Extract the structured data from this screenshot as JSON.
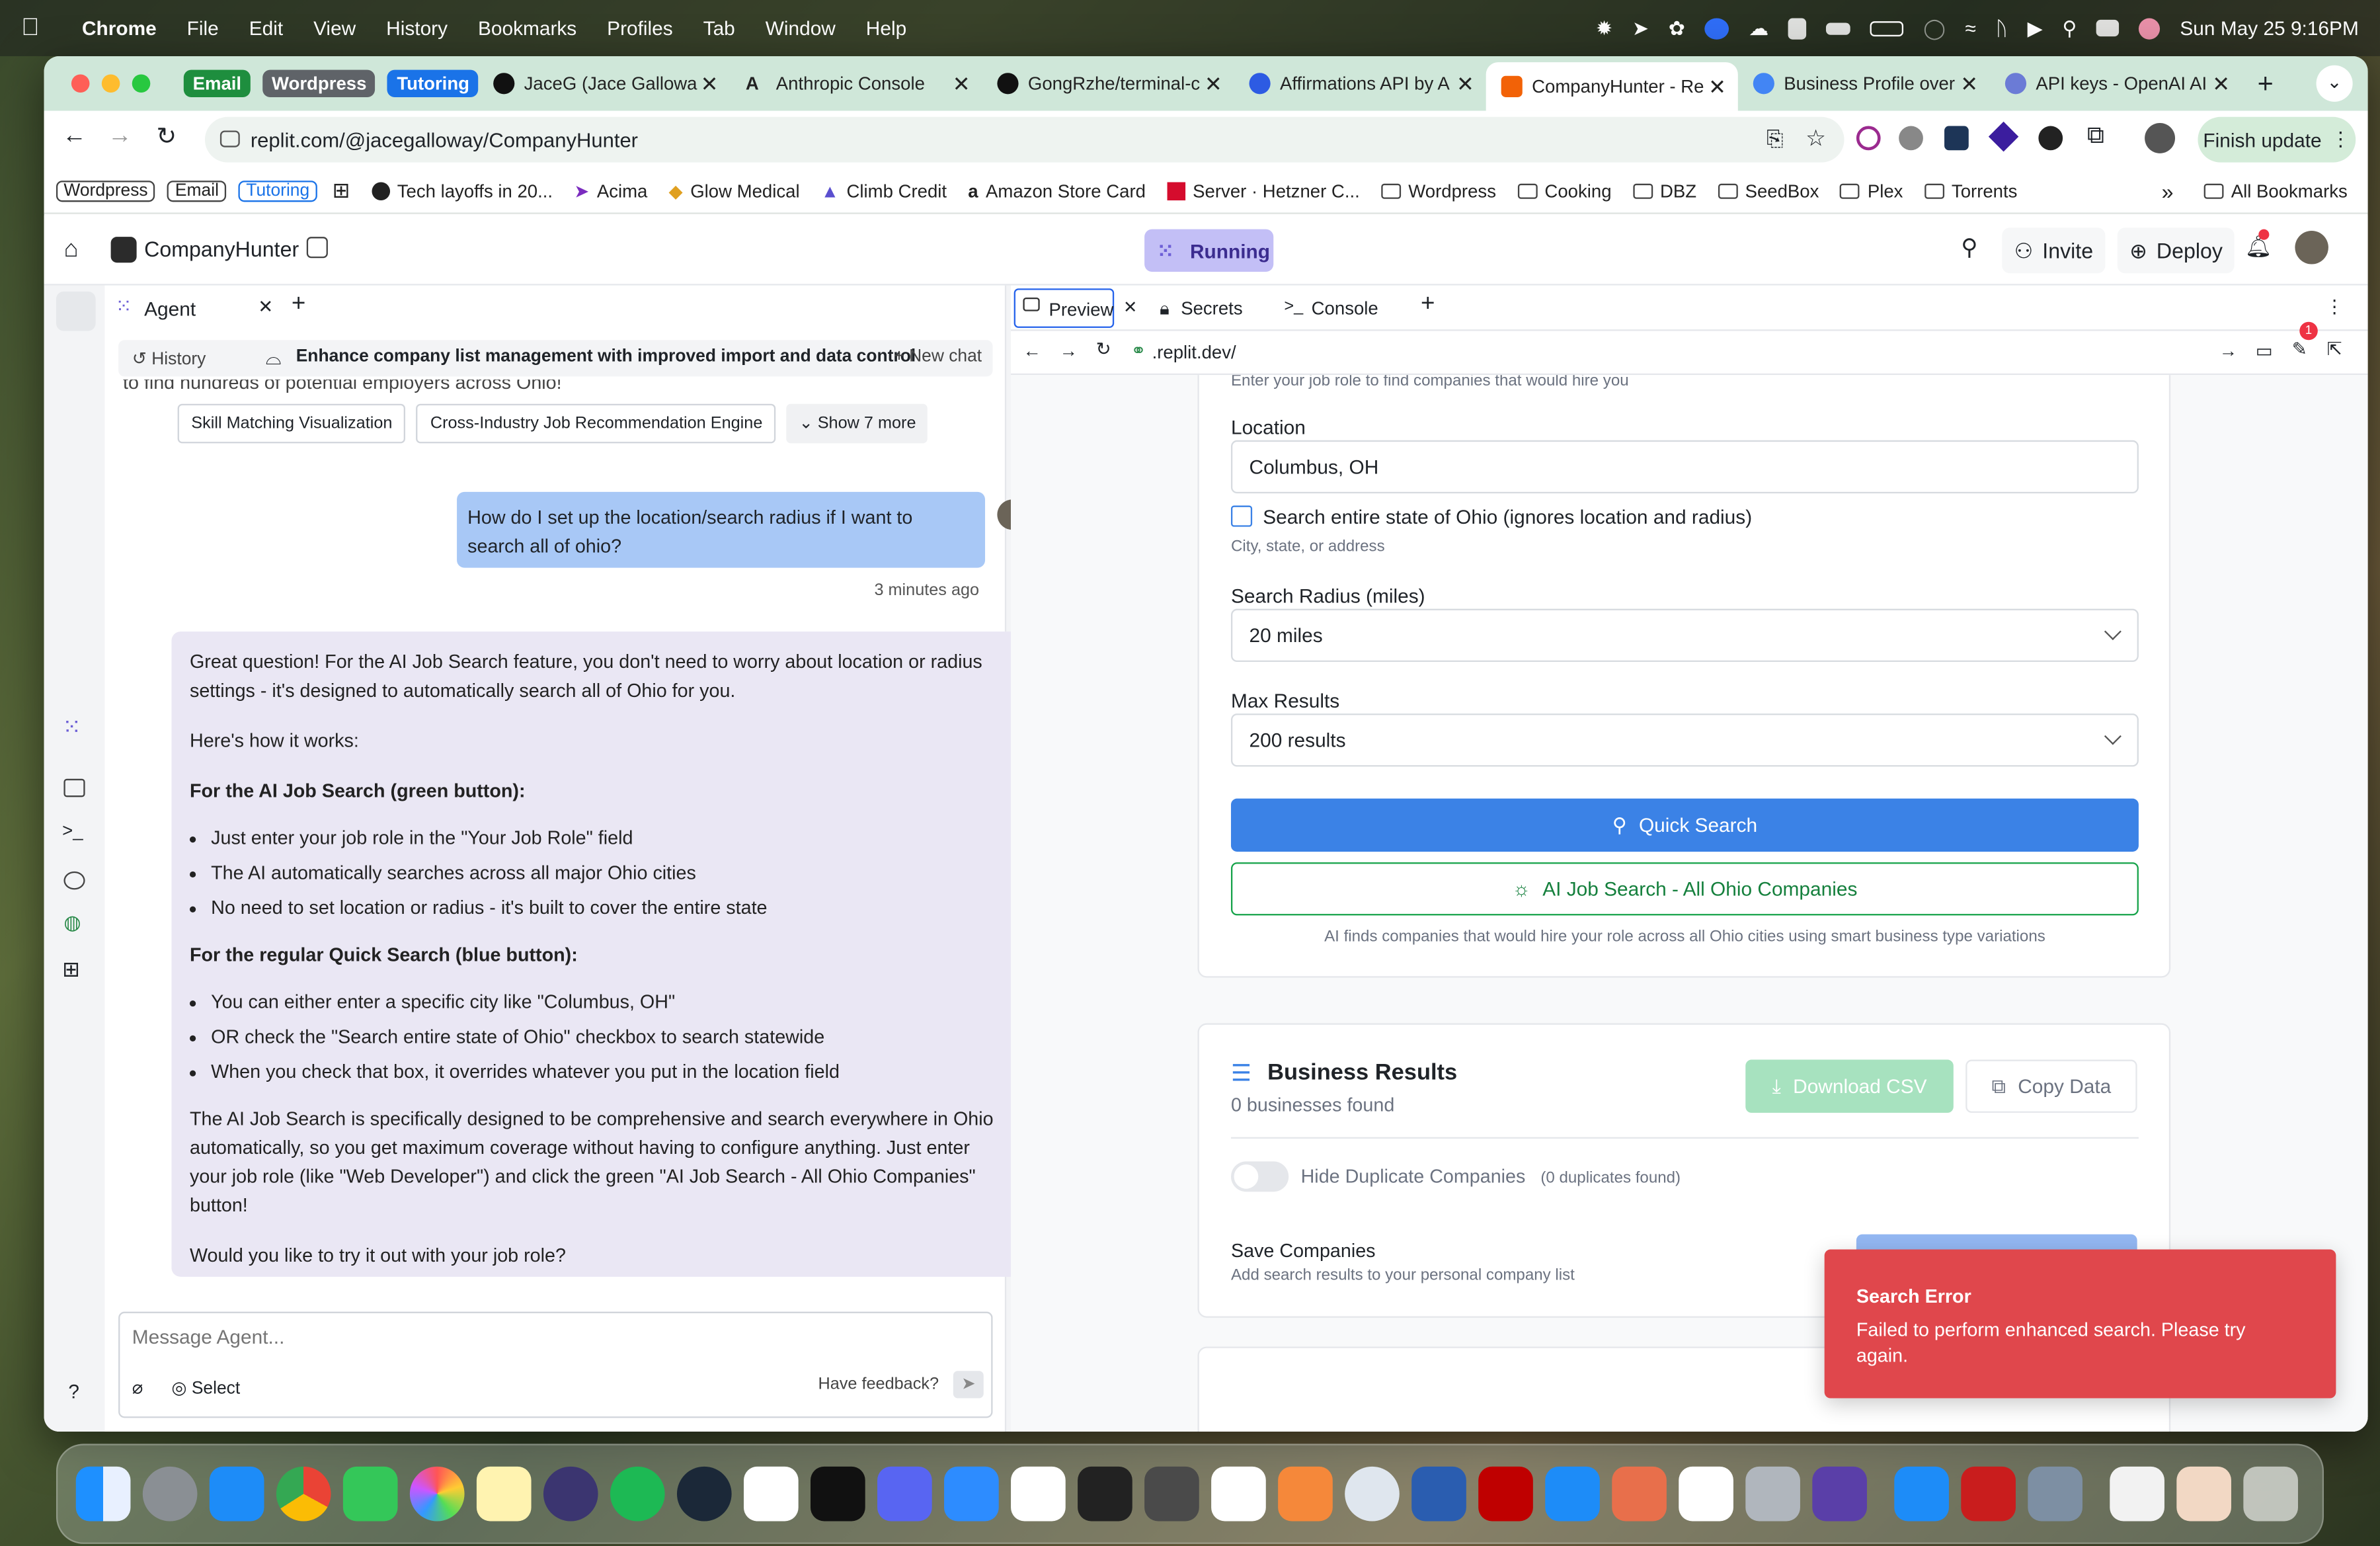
{
  "menubar": {
    "app": "Chrome",
    "items": [
      "File",
      "Edit",
      "View",
      "History",
      "Bookmarks",
      "Profiles",
      "Tab",
      "Window",
      "Help"
    ],
    "clock": "Sun May 25  9:16PM"
  },
  "tab_groups": [
    "Email",
    "Wordpress",
    "Tutoring"
  ],
  "tabs": [
    "JaceG (Jace Gallowa",
    "Anthropic Console",
    "GongRzhe/terminal-c",
    "Affirmations API by A",
    "CompanyHunter - Re",
    "Business Profile over",
    "API keys - OpenAI AI"
  ],
  "url": "replit.com/@jacegalloway/CompanyHunter",
  "finish_update": "Finish update",
  "bookmarks": {
    "boxes": [
      "Wordpress",
      "Email",
      "Tutoring"
    ],
    "items": [
      "Tech layoffs in 20...",
      "Acima",
      "Glow Medical",
      "Climb Credit",
      "Amazon Store Card",
      "Server · Hetzner C...",
      "Wordpress",
      "Cooking",
      "DBZ",
      "SeedBox",
      "Plex",
      "Torrents"
    ],
    "all": "All Bookmarks"
  },
  "replit": {
    "project": "CompanyHunter",
    "running": "Running",
    "invite": "Invite",
    "deploy": "Deploy"
  },
  "agent": {
    "tab": "Agent",
    "history": "History",
    "chat_title": "Enhance company list management with improved import and data control",
    "new_chat": "New chat",
    "cut_text": "to find hundreds of potential employers across Ohio!",
    "chips": [
      "Skill Matching Visualization",
      "Cross-Industry Job Recommendation Engine",
      "Show 7 more"
    ],
    "user_msg": "How do I set up the location/search radius if I want to search all of ohio?",
    "user_time": "3 minutes ago",
    "reply_p1": "Great question! For the AI Job Search feature, you don't need to worry about location or radius settings - it's designed to automatically search all of Ohio for you.",
    "reply_p2": "Here's how it works:",
    "reply_h1": "For the AI Job Search (green button):",
    "reply_l1": [
      "Just enter your job role in the \"Your Job Role\" field",
      "The AI automatically searches across all major Ohio cities",
      "No need to set location or radius - it's built to cover the entire state"
    ],
    "reply_h2": "For the regular Quick Search (blue button):",
    "reply_l2": [
      "You can either enter a specific city like \"Columbus, OH\"",
      "OR check the \"Search entire state of Ohio\" checkbox to search statewide",
      "When you check that box, it overrides whatever you put in the location field"
    ],
    "reply_p3": "The AI Job Search is specifically designed to be comprehensive and search everywhere in Ohio automatically, so you get maximum coverage without having to configure anything. Just enter your job role (like \"Web Developer\") and click the green \"AI Job Search - All Ohio Companies\" button!",
    "reply_p4": "Would you like to try it out with your job role?",
    "input_placeholder": "Message Agent...",
    "select": "Select",
    "feedback": "Have feedback?"
  },
  "preview": {
    "tabs": [
      "Preview",
      "Secrets",
      "Console"
    ],
    "url": ".replit.dev/",
    "badge": "1",
    "cut_hint": "Enter your job role to find companies that would hire you",
    "location_label": "Location",
    "location_value": "Columbus, OH",
    "state_checkbox": "Search entire state of Ohio (ignores location and radius)",
    "location_hint": "City, state, or address",
    "radius_label": "Search Radius (miles)",
    "radius_value": "20 miles",
    "max_label": "Max Results",
    "max_value": "200 results",
    "quick_search": "Quick Search",
    "ai_search": "AI Job Search - All Ohio Companies",
    "ai_hint": "AI finds companies that would hire your role across all Ohio cities using smart business type variations",
    "results_title": "Business Results",
    "results_count": "0 businesses found",
    "download": "Download CSV",
    "copy": "Copy Data",
    "hide_dup": "Hide Duplicate Companies",
    "dup_count": "(0 duplicates found)",
    "save_title": "Save Companies",
    "save_sub": "Add search results to your personal company list"
  },
  "toast": {
    "title": "Search Error",
    "body": "Failed to perform enhanced search. Please try again."
  },
  "colors": {
    "accent_blue": "#3b82e6",
    "accent_green": "#16a34a",
    "toast_red": "#e0474c",
    "running_purple": "#c3bff6"
  }
}
